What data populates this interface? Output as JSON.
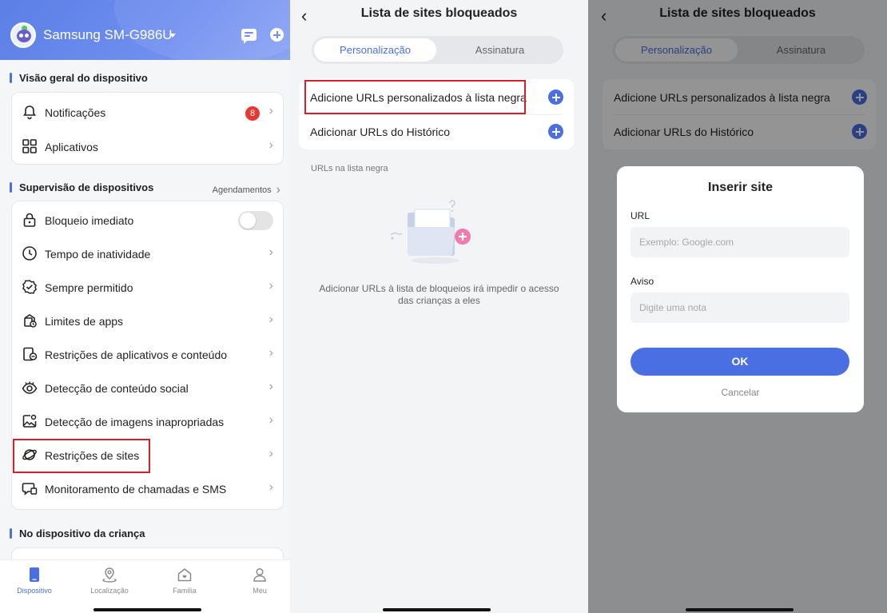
{
  "colors": {
    "accent": "#4a6fe3",
    "badge": "#e53935",
    "highlight": "#d8202b"
  },
  "panel1": {
    "device_name": "Samsung SM-G986U",
    "section_overview": "Visão geral do dispositivo",
    "overview_items": [
      {
        "label": "Notificações",
        "badge": "8",
        "icon": "bell-icon"
      },
      {
        "label": "Aplicativos",
        "icon": "apps-grid-icon"
      }
    ],
    "section_supervision": "Supervisão de dispositivos",
    "supervision_link": "Agendamentos",
    "supervision_items": [
      {
        "label": "Bloqueio imediato",
        "icon": "lock-icon",
        "toggle": false
      },
      {
        "label": "Tempo de inatividade",
        "icon": "clock-icon"
      },
      {
        "label": "Sempre permitido",
        "icon": "shield-check-icon"
      },
      {
        "label": "Limites de apps",
        "icon": "app-limit-icon"
      },
      {
        "label": "Restrições de aplicativos e conteúdo",
        "icon": "content-restriction-icon"
      },
      {
        "label": "Detecção de conteúdo social",
        "icon": "eye-icon"
      },
      {
        "label": "Detecção de imagens inapropriadas",
        "icon": "image-detect-icon"
      },
      {
        "label": "Restrições de sites",
        "icon": "planet-icon"
      },
      {
        "label": "Monitoramento de chamadas e SMS",
        "icon": "chat-monitor-icon"
      }
    ],
    "section_child": "No dispositivo da criança",
    "tabs": [
      {
        "label": "Dispositivo",
        "active": true,
        "icon": "device-icon"
      },
      {
        "label": "Localização",
        "active": false,
        "icon": "location-icon"
      },
      {
        "label": "Família",
        "active": false,
        "icon": "family-home-icon"
      },
      {
        "label": "Meu",
        "active": false,
        "icon": "person-icon"
      }
    ]
  },
  "panel2": {
    "title": "Lista de sites bloqueados",
    "seg_left": "Personalização",
    "seg_right": "Assinatura",
    "item1": "Adicione URLs personalizados à lista negra",
    "item2": "Adicionar URLs do Histórico",
    "blacklist_label": "URLs na lista negra",
    "empty_line1": "Adicionar URLs à lista de bloqueios irá impedir o acesso",
    "empty_line2": "das crianças a eles"
  },
  "panel3": {
    "title": "Lista de sites bloqueados",
    "seg_left": "Personalização",
    "seg_right": "Assinatura",
    "item1": "Adicione URLs personalizados à lista negra",
    "item2": "Adicionar URLs do Histórico",
    "dialog": {
      "title": "Inserir site",
      "url_label": "URL",
      "url_placeholder": "Exemplo: Google.com",
      "note_label": "Aviso",
      "note_placeholder": "Digite uma nota",
      "ok": "OK",
      "cancel": "Cancelar"
    }
  }
}
